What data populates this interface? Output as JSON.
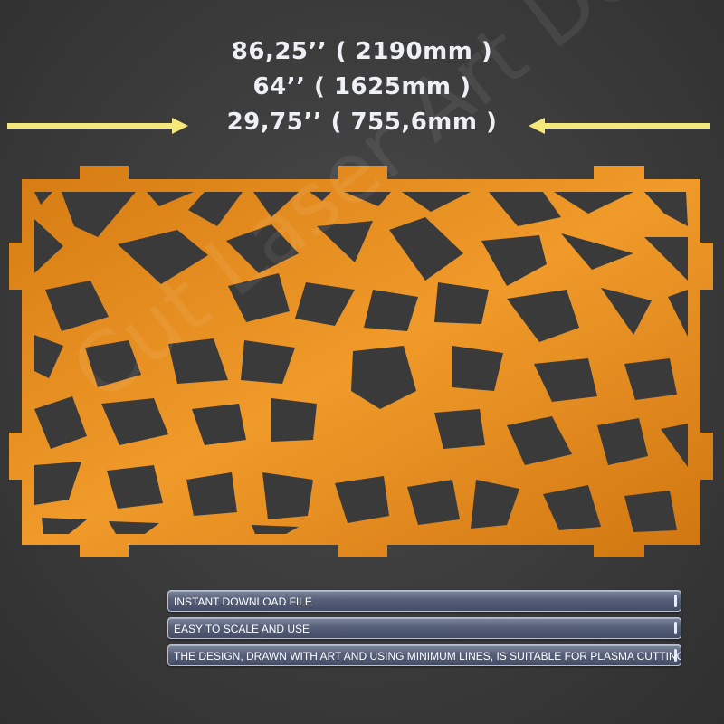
{
  "dimensions": {
    "line1": "86,25’’ ( 2190mm )",
    "line2": "64’’ ( 1625mm )",
    "line3": "29,75’’ ( 755,6mm )"
  },
  "watermark": "Cut Laser Art Design",
  "features": [
    "INSTANT DOWNLOAD FILE",
    "EASY TO SCALE AND USE",
    "THE DESIGN, DRAWN WITH ART AND USING MINIMUM LINES, IS SUITABLE FOR PLASMA CUTTING"
  ],
  "colors": {
    "background": "#3b3b3b",
    "panel": "#e38a1c",
    "arrow": "#f3e879",
    "dimension_text": "#eef0f6",
    "feature_bar": "#57607a"
  },
  "icons": {
    "left_arrow": "right-arrow-icon",
    "right_arrow": "left-arrow-icon"
  }
}
